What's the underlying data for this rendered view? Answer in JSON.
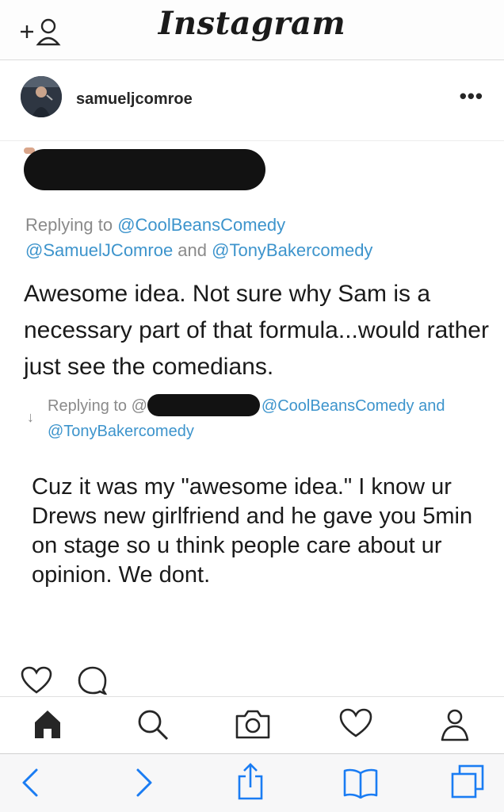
{
  "app": {
    "title": "Instagram"
  },
  "post": {
    "username": "samueljcomroe",
    "more_label": "•••"
  },
  "tweet": {
    "reply1_prefix": "Replying to ",
    "reply1_handle1": "@CoolBeansComedy",
    "reply1_handle2": "@SamuelJComroe",
    "reply1_and": " and ",
    "reply1_handle3": "@TonyBakercomedy",
    "text1": "Awesome idea. Not sure why Sam is a necessary part of that formula...would rather just see the comedians.",
    "reply2_prefix": "Replying to @",
    "reply2_handle1": "@CoolBeansComedy",
    "reply2_and": " and",
    "reply2_handle2": "@TonyBakercomedy",
    "reply_arrow": "↓",
    "text2": "Cuz it was my \"awesome idea.\" I know ur Drews new girlfriend and he gave you 5min on stage so u think people care about ur opinion. We dont."
  },
  "actions": [
    "heart-icon",
    "comment-icon"
  ],
  "tabbar": [
    "home-icon",
    "search-icon",
    "camera-icon",
    "activity-heart-icon",
    "profile-icon"
  ],
  "safari": [
    "back-icon",
    "forward-icon",
    "share-icon",
    "bookmarks-icon",
    "tabs-icon"
  ],
  "colors": {
    "link": "#3d94cc",
    "safari_blue": "#1a7cf3",
    "redaction": "#121212"
  }
}
